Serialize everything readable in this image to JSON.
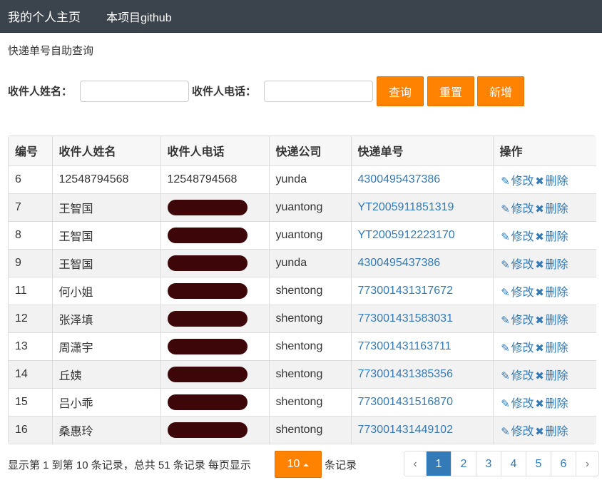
{
  "nav": {
    "home": "我的个人主页",
    "github": "本项目github",
    "bg_color": "#3b434c"
  },
  "subtitle": "快递单号自助查询",
  "form": {
    "name_label": "收件人姓名：",
    "phone_label": "收件人电话：",
    "name_value": "",
    "phone_value": "",
    "query_button": "查询",
    "reset_button": "重置",
    "add_button": "新增",
    "accent_color": "#ff8200"
  },
  "table": {
    "headers": [
      "编号",
      "收件人姓名",
      "收件人电话",
      "快递公司",
      "快递单号",
      "操作"
    ],
    "edit_label": "修改",
    "delete_label": "删除",
    "rows": [
      {
        "id": "6",
        "name": "12548794568",
        "phone": "12548794568",
        "phone_redacted": false,
        "company": "yunda",
        "tracking": "4300495437386"
      },
      {
        "id": "7",
        "name": "王智国",
        "phone": "",
        "phone_redacted": true,
        "company": "yuantong",
        "tracking": "YT2005911851319"
      },
      {
        "id": "8",
        "name": "王智国",
        "phone": "",
        "phone_redacted": true,
        "company": "yuantong",
        "tracking": "YT2005912223170"
      },
      {
        "id": "9",
        "name": "王智国",
        "phone": "",
        "phone_redacted": true,
        "company": "yunda",
        "tracking": "4300495437386"
      },
      {
        "id": "11",
        "name": "何小姐",
        "phone": "",
        "phone_redacted": true,
        "company": "shentong",
        "tracking": "773001431317672"
      },
      {
        "id": "12",
        "name": "张泽填",
        "phone": "",
        "phone_redacted": true,
        "company": "shentong",
        "tracking": "773001431583031"
      },
      {
        "id": "13",
        "name": "周潇宇",
        "phone": "",
        "phone_redacted": true,
        "company": "shentong",
        "tracking": "773001431163711"
      },
      {
        "id": "14",
        "name": "丘姨",
        "phone": "",
        "phone_redacted": true,
        "company": "shentong",
        "tracking": "773001431385356"
      },
      {
        "id": "15",
        "name": "吕小乖",
        "phone": "",
        "phone_redacted": true,
        "company": "shentong",
        "tracking": "773001431516870"
      },
      {
        "id": "16",
        "name": "桑惠玲",
        "phone": "",
        "phone_redacted": true,
        "company": "shentong",
        "tracking": "773001431449102"
      }
    ]
  },
  "footer": {
    "summary": "显示第 1 到第 10 条记录，总共 51 条记录 每页显示",
    "page_size": "10",
    "suffix": "条记录"
  },
  "pagination": {
    "prev": "‹",
    "next": "›",
    "pages": [
      "1",
      "2",
      "3",
      "4",
      "5",
      "6"
    ],
    "active_page": "1"
  }
}
